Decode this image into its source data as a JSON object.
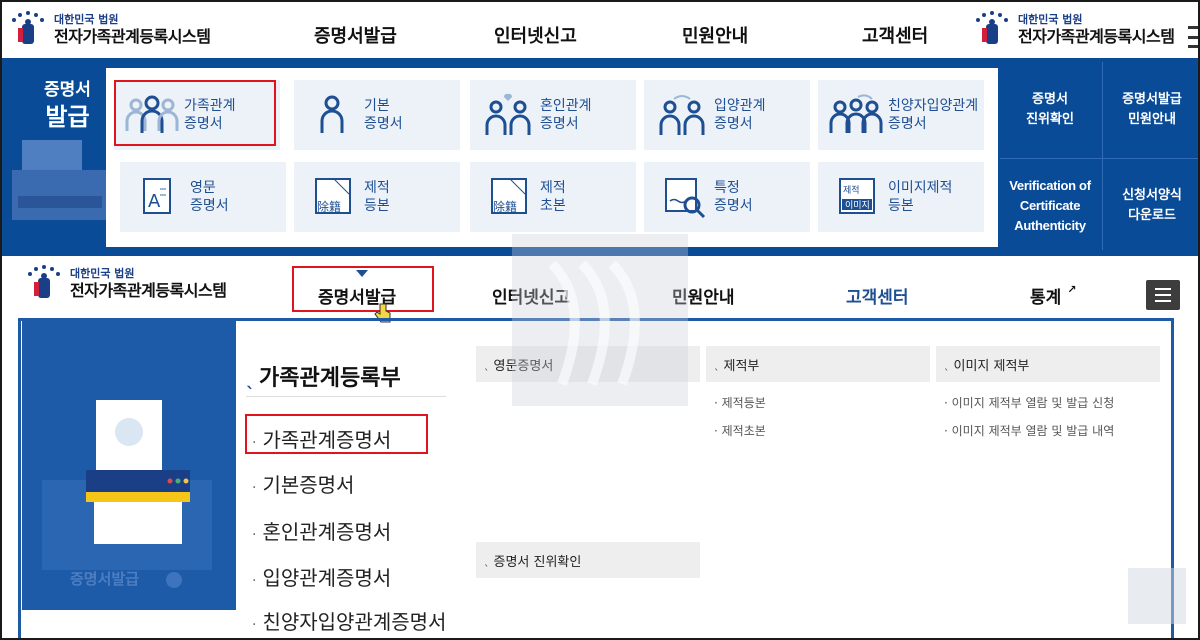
{
  "header": {
    "logo_small": "대한민국 법원",
    "logo_large": "전자가족관계등록시스템",
    "nav": [
      "증명서발급",
      "인터넷신고",
      "민원안내",
      "고객센터"
    ]
  },
  "banner": {
    "title_line1": "증명서",
    "title_line2": "발급",
    "cards": [
      {
        "label": "가족관계\n증명서",
        "icon": "family-icon"
      },
      {
        "label": "기본\n증명서",
        "icon": "person-icon"
      },
      {
        "label": "혼인관계\n증명서",
        "icon": "couple-heart-icon"
      },
      {
        "label": "입양관계\n증명서",
        "icon": "adoption-icon"
      },
      {
        "label": "친양자입양관계\n증명서",
        "icon": "family-adoption-icon"
      },
      {
        "label": "영문\n증명서",
        "icon": "english-document-icon"
      },
      {
        "label": "제적\n등본",
        "icon": "removed-register-icon"
      },
      {
        "label": "제적\n초본",
        "icon": "removed-register-icon"
      },
      {
        "label": "특정\n증명서",
        "icon": "search-document-icon"
      },
      {
        "label": "이미지제적\n등본",
        "icon": "image-register-icon"
      }
    ],
    "stamp_text_a": "除籍",
    "stamp_text_b": "이미지",
    "stamp_text_c": "제적",
    "side": [
      "증명서\n진위확인",
      "증명서발급\n민원안내",
      "Verification of\nCertificate\nAuthenticity",
      "신청서양식\n다운로드"
    ]
  },
  "nav2": {
    "logo_small": "대한민국 법원",
    "logo_large": "전자가족관계등록시스템",
    "items": [
      "증명서발급",
      "인터넷신고",
      "민원안내",
      "고객센터",
      "통계"
    ]
  },
  "dropdown": {
    "side_label": "증명서발급",
    "section_title": "가족관계등록부",
    "items": [
      "가족관계증명서",
      "기본증명서",
      "혼인관계증명서",
      "입양관계증명서",
      "친양자입양관계증명서"
    ],
    "col_english": "영문증명서",
    "col_verify": "증명서 진위확인",
    "col_removed": "제적부",
    "removed_items": [
      "제적등본",
      "제적초본"
    ],
    "col_image": "이미지 제적부",
    "image_items": [
      "이미지 제적부 열람 및 발급 신청",
      "이미지 제적부 열람 및 발급 내역"
    ]
  },
  "colors": {
    "brand_blue": "#0a4b98",
    "highlight": "#e0141e",
    "card_bg": "#edf2f8"
  }
}
